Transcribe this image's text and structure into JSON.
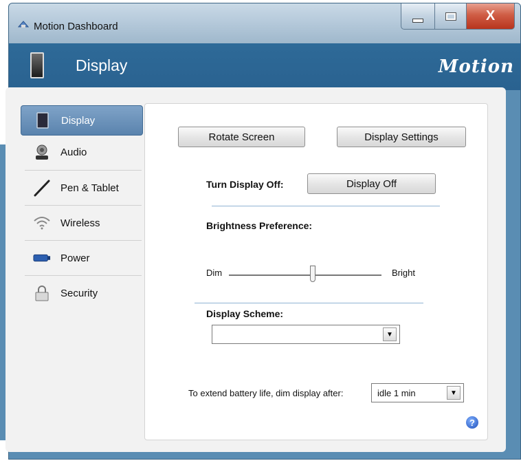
{
  "window": {
    "title": "Motion Dashboard",
    "close_label": "X"
  },
  "header": {
    "title": "Display",
    "brand": "Motion"
  },
  "sidebar": {
    "items": [
      {
        "label": "Display",
        "icon": "tablet-icon",
        "selected": true
      },
      {
        "label": "Audio",
        "icon": "headset-icon"
      },
      {
        "label": "Pen & Tablet",
        "icon": "pen-icon"
      },
      {
        "label": "Wireless",
        "icon": "wireless-icon"
      },
      {
        "label": "Power",
        "icon": "battery-icon"
      },
      {
        "label": "Security",
        "icon": "lock-icon"
      }
    ]
  },
  "main": {
    "rotate_button": "Rotate Screen",
    "display_settings_button": "Display Settings",
    "turn_off_label": "Turn Display Off:",
    "display_off_button": "Display Off",
    "brightness_label": "Brightness Preference:",
    "brightness": {
      "min_label": "Dim",
      "max_label": "Bright",
      "value_fraction": 0.55
    },
    "scheme_label": "Display Scheme:",
    "scheme_value": "",
    "battery_label": "To extend battery life, dim display after:",
    "battery_value": "idle 1 min",
    "help_icon": "?"
  },
  "colors": {
    "header_blue": "#2e6a98",
    "selected_nav": "#5a83ad",
    "separator_blue": "#8fb2d3"
  }
}
